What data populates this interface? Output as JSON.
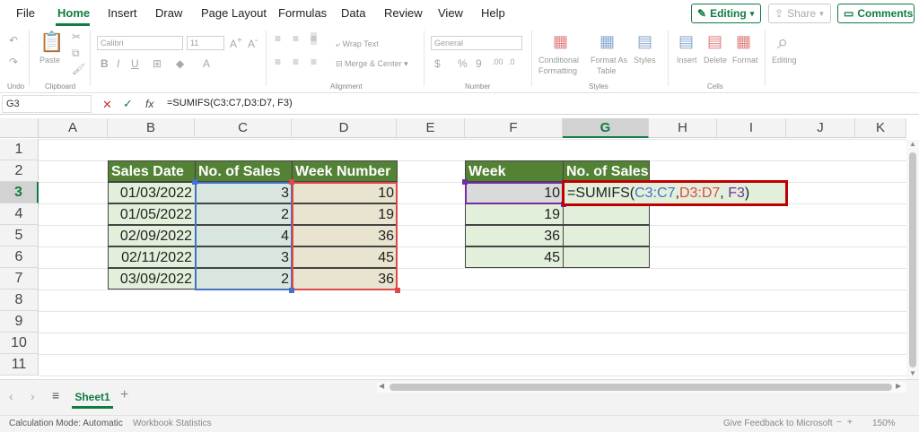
{
  "menu": {
    "file": "File",
    "home": "Home",
    "insert": "Insert",
    "draw": "Draw",
    "page_layout": "Page Layout",
    "formulas": "Formulas",
    "data": "Data",
    "review": "Review",
    "view": "View",
    "help": "Help"
  },
  "top_buttons": {
    "editing": "Editing",
    "share": "Share",
    "comments": "Comments"
  },
  "ribbon": {
    "undo_label": "Undo",
    "clipboard_label": "Clipboard",
    "paste": "Paste",
    "font_name": "Calibri",
    "font_size": "11",
    "font_label": "Font",
    "wrap_text": "Wrap Text",
    "merge_center": "Merge & Center",
    "alignment_label": "Alignment",
    "number_format": "General",
    "number_label": "Number",
    "conditional": "Conditional",
    "formatting": "Formatting",
    "format_as": "Format As",
    "table": "Table",
    "styles": "Styles",
    "styles_label": "Styles",
    "insert": "Insert",
    "delete": "Delete",
    "format": "Format",
    "cells_label": "Cells",
    "editing": "Editing"
  },
  "formula_bar": {
    "cell_ref": "G3",
    "fx": "fx",
    "formula": "=SUMIFS(C3:C7,D3:D7, F3)"
  },
  "columns": [
    "A",
    "B",
    "C",
    "D",
    "E",
    "F",
    "G",
    "H",
    "I",
    "J",
    "K"
  ],
  "rows": [
    "1",
    "2",
    "3",
    "4",
    "5",
    "6",
    "7",
    "8",
    "9",
    "10",
    "11"
  ],
  "table1": {
    "headers": [
      "Sales Date",
      "No. of Sales",
      "Week Number"
    ],
    "rows": [
      [
        "01/03/2022",
        "3",
        "10"
      ],
      [
        "01/05/2022",
        "2",
        "19"
      ],
      [
        "02/09/2022",
        "4",
        "36"
      ],
      [
        "02/11/2022",
        "3",
        "45"
      ],
      [
        "03/09/2022",
        "2",
        "36"
      ]
    ]
  },
  "table2": {
    "headers": [
      "Week",
      "No. of Sales"
    ],
    "weeks": [
      "10",
      "19",
      "36",
      "45"
    ],
    "formula_prefix": "=SUMIFS(",
    "arg1": "C3:C7",
    "comma1": ",",
    "arg2": "D3:D7",
    "comma2": ", ",
    "arg3": "F3",
    "formula_suffix": ")"
  },
  "sheet_tab": "Sheet1",
  "status": {
    "calc_mode": "Calculation Mode: Automatic",
    "wb_stats": "Workbook Statistics",
    "feedback": "Give Feedback to Microsoft",
    "zoom": "150%"
  },
  "colors": {
    "accent": "#107c41",
    "header_fill": "#548235",
    "data_fill": "#e2efda",
    "range_blue": "#4472c4",
    "range_red": "#e04848",
    "range_purple": "#7030a0",
    "active_border": "#c00000"
  }
}
